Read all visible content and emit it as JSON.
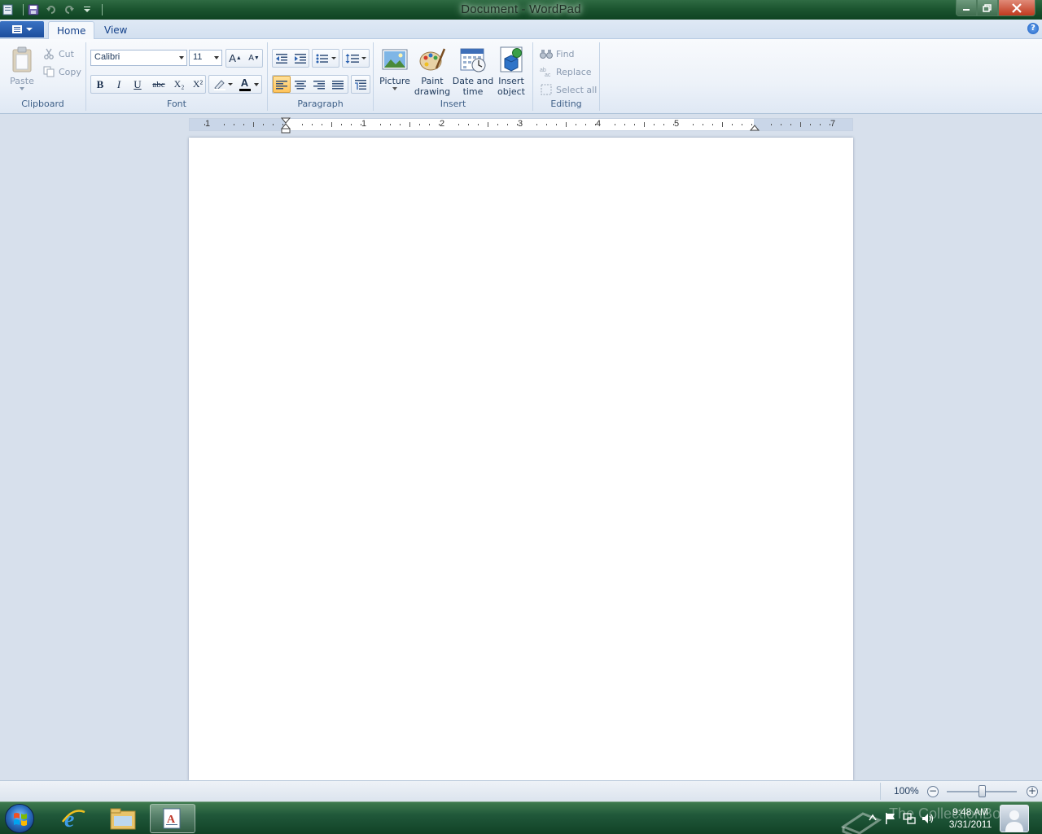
{
  "window": {
    "title": "Document - WordPad"
  },
  "tabs": [
    {
      "label": "Home",
      "active": true
    },
    {
      "label": "View",
      "active": false
    }
  ],
  "help": "?",
  "clipboard": {
    "label": "Clipboard",
    "paste": "Paste",
    "cut": "Cut",
    "copy": "Copy"
  },
  "font": {
    "label": "Font",
    "family": "Calibri",
    "size": "11",
    "bold": "B",
    "italic": "I",
    "underline": "U",
    "strikethrough": "abc",
    "subscript": "X₂",
    "superscript": "X²",
    "font_color_letter": "A",
    "grow_letter": "A",
    "shrink_letter": "A"
  },
  "paragraph": {
    "label": "Paragraph"
  },
  "insert": {
    "label": "Insert",
    "picture": "Picture",
    "paint_1": "Paint",
    "paint_2": "drawing",
    "date_1": "Date and",
    "date_2": "time",
    "object_1": "Insert",
    "object_2": "object"
  },
  "editing": {
    "label": "Editing",
    "find": "Find",
    "replace": "Replace",
    "select_all": "Select all"
  },
  "ruler": {
    "numbers": [
      "1",
      "1",
      "2",
      "3",
      "4",
      "5",
      "7"
    ]
  },
  "status": {
    "zoom": "100%",
    "zoom_level_percent": 100,
    "minus": "−",
    "plus": "+"
  },
  "taskbar": {
    "time": "9:48 AM",
    "date": "3/31/2011",
    "watermark": "The CollectionBook"
  },
  "colors": {
    "accent": "#1c4d9c",
    "ribbon": "#edf2f9",
    "background": "#d7e0ec",
    "taskbar": "#20583a"
  }
}
